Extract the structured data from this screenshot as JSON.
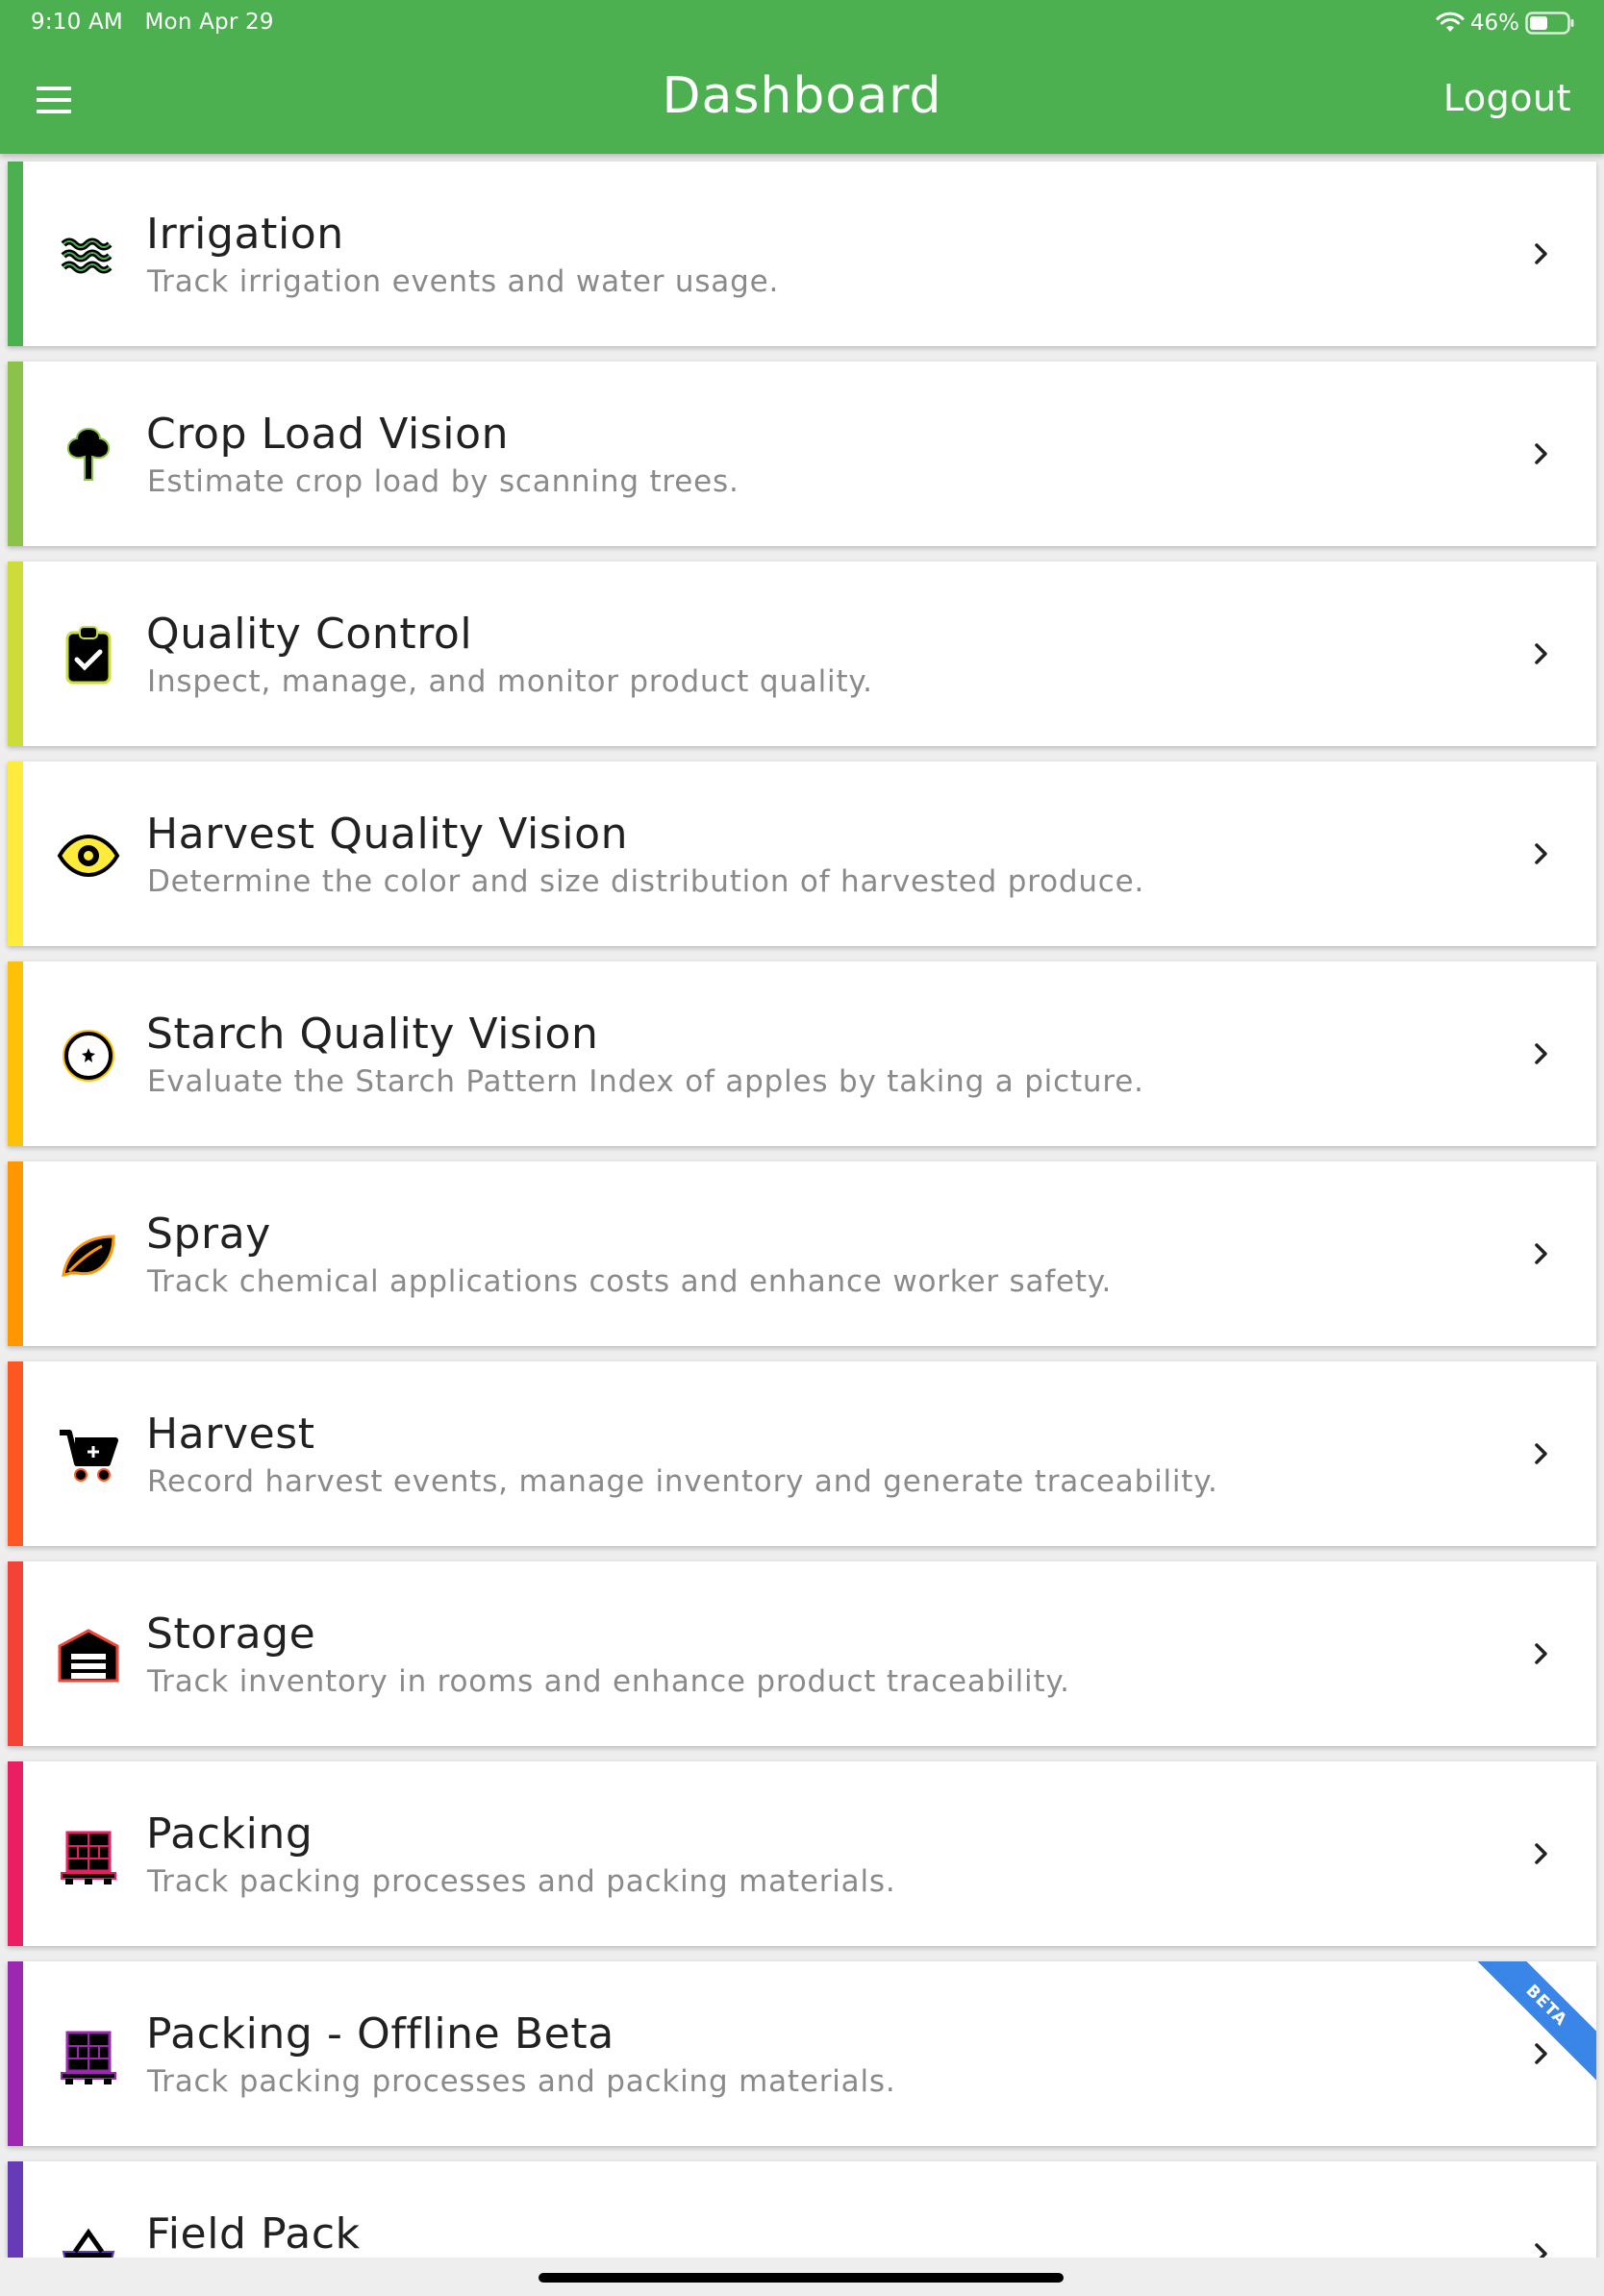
{
  "status_bar": {
    "time": "9:10 AM",
    "date": "Mon Apr 29",
    "battery": "46%"
  },
  "header": {
    "title": "Dashboard",
    "logout_label": "Logout"
  },
  "modules": [
    {
      "title": "Irrigation",
      "subtitle": "Track irrigation events and water usage.",
      "color": "#4caf50",
      "icon": "water-waves-icon"
    },
    {
      "title": "Crop Load Vision",
      "subtitle": "Estimate crop load by scanning trees.",
      "color": "#8bc34a",
      "icon": "tree-icon"
    },
    {
      "title": "Quality Control",
      "subtitle": "Inspect, manage, and monitor product quality.",
      "color": "#cddc39",
      "icon": "clipboard-check-icon"
    },
    {
      "title": "Harvest Quality Vision",
      "subtitle": "Determine the color and size distribution of harvested produce.",
      "color": "#ffeb3b",
      "icon": "eye-icon"
    },
    {
      "title": "Starch Quality Vision",
      "subtitle": "Evaluate the Starch Pattern Index of apples by taking a picture.",
      "color": "#ffc107",
      "icon": "apple-slice-icon"
    },
    {
      "title": "Spray",
      "subtitle": "Track chemical applications costs and enhance worker safety.",
      "color": "#ff9800",
      "icon": "leaf-icon"
    },
    {
      "title": "Harvest",
      "subtitle": "Record harvest events, manage inventory and generate traceability.",
      "color": "#ff5722",
      "icon": "cart-plus-icon"
    },
    {
      "title": "Storage",
      "subtitle": "Track inventory in rooms and enhance product traceability.",
      "color": "#f44336",
      "icon": "warehouse-icon"
    },
    {
      "title": "Packing",
      "subtitle": "Track packing processes and packing materials.",
      "color": "#e91e63",
      "icon": "pallet-boxes-icon"
    },
    {
      "title": "Packing - Offline Beta",
      "subtitle": "Track packing processes and packing materials.",
      "color": "#9c27b0",
      "icon": "pallet-boxes-icon",
      "badge": "BETA"
    },
    {
      "title": "Field Pack",
      "subtitle": "",
      "color": "#673ab7",
      "icon": "basket-icon"
    }
  ]
}
